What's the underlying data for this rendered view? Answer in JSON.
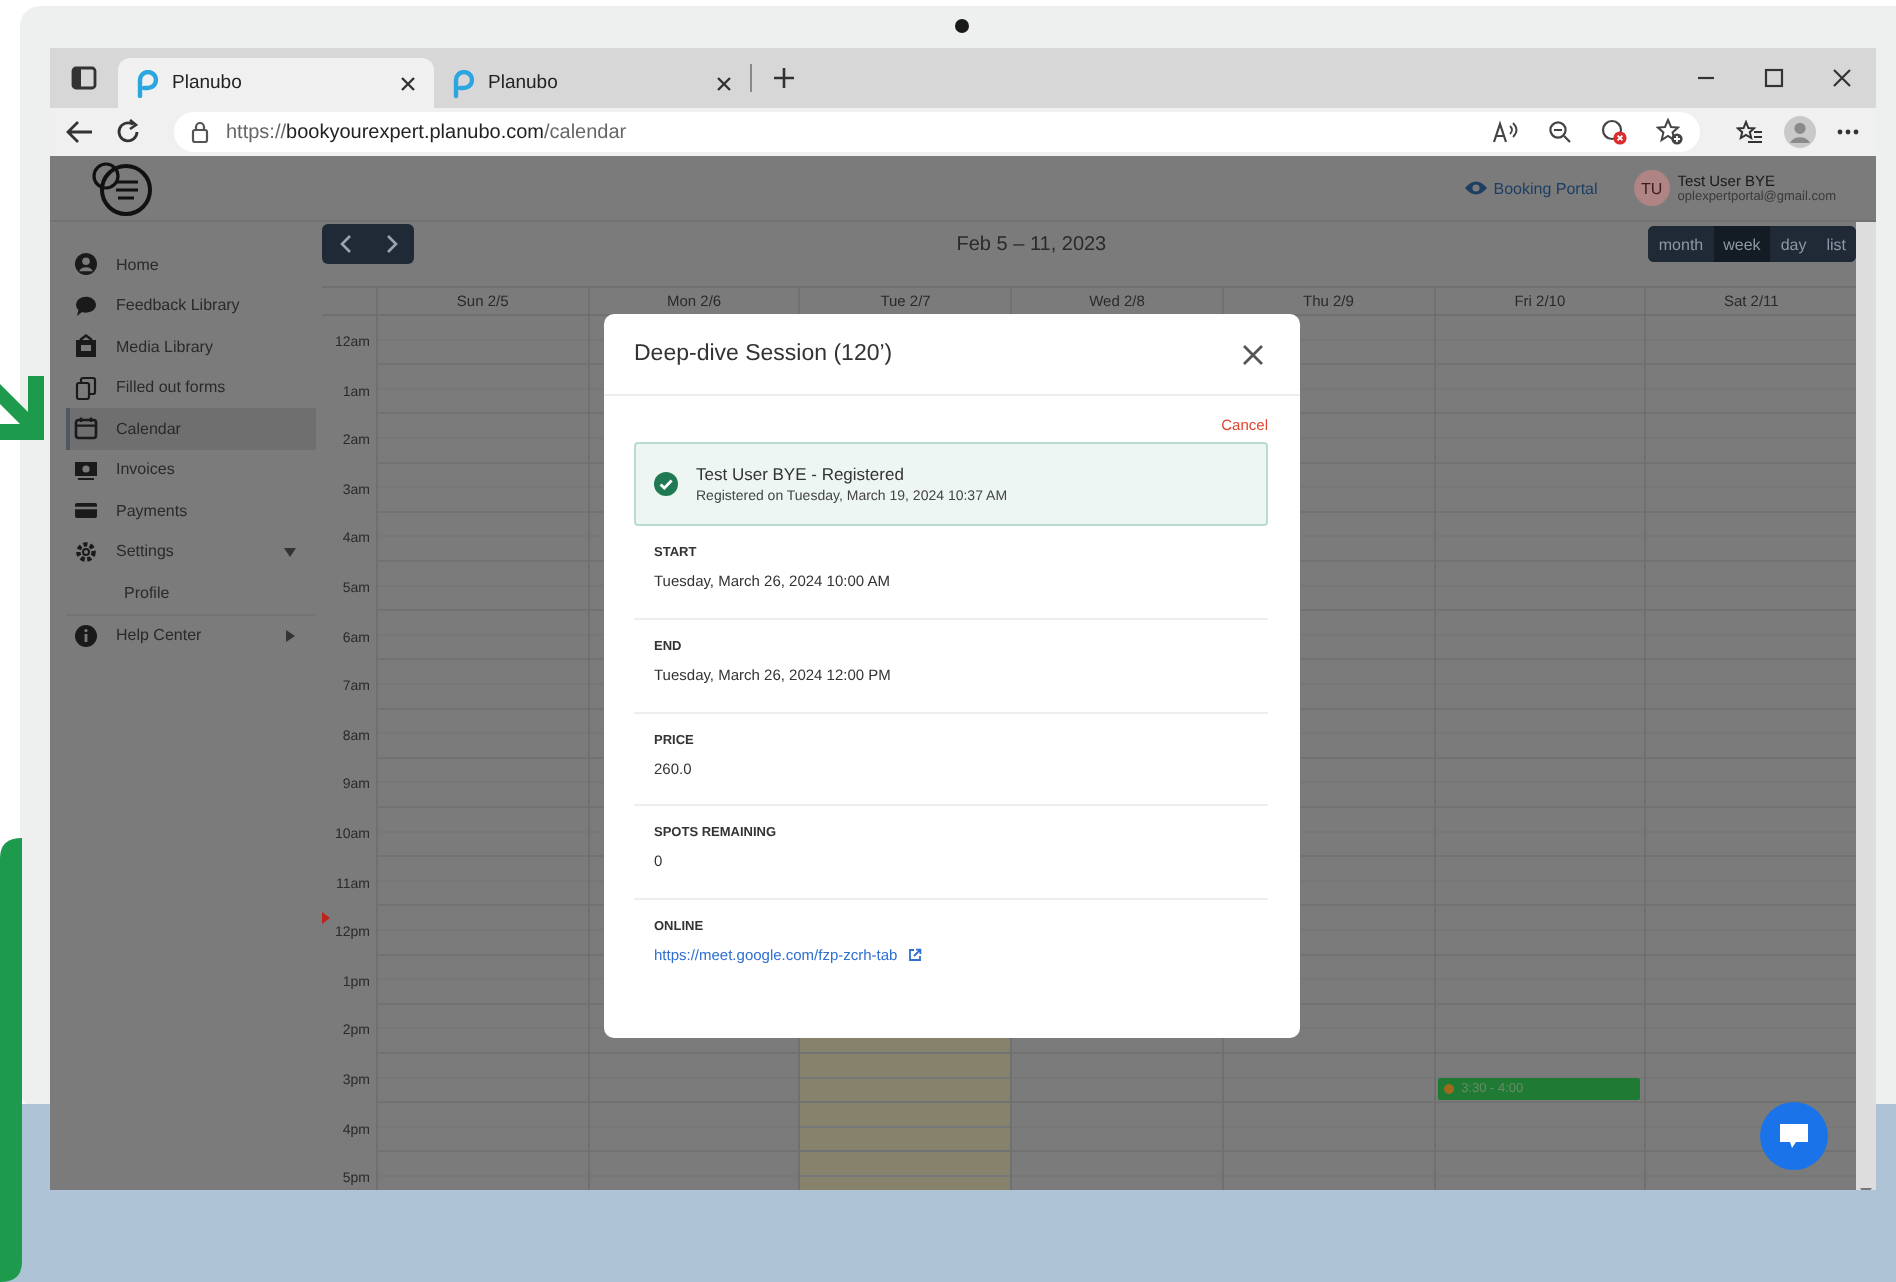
{
  "browser": {
    "tabs": [
      {
        "title": "Planubo",
        "selected": true
      },
      {
        "title": "Planubo",
        "selected": false
      }
    ],
    "url": {
      "scheme": "https://",
      "host": "bookyourexpert.planubo.com",
      "path": "/calendar"
    }
  },
  "header": {
    "portal_link": "Booking Portal",
    "user": {
      "initials": "TU",
      "name": "Test User BYE",
      "email": "oplexpertportal@gmail.com"
    }
  },
  "sidebar": {
    "items": [
      {
        "label": "Home",
        "selected": false
      },
      {
        "label": "Feedback Library",
        "selected": false
      },
      {
        "label": "Media Library",
        "selected": false
      },
      {
        "label": "Filled out forms",
        "selected": false
      },
      {
        "label": "Calendar",
        "selected": true
      },
      {
        "label": "Invoices",
        "selected": false
      },
      {
        "label": "Payments",
        "selected": false
      },
      {
        "label": "Settings",
        "selected": false,
        "expanded": true,
        "children": [
          {
            "label": "Profile",
            "selected": false
          }
        ]
      },
      {
        "label": "Help Center",
        "selected": false,
        "expanded": false
      }
    ]
  },
  "calendar": {
    "range_title": "Feb 5 – 11, 2023",
    "views": [
      {
        "label": "month",
        "selected": false
      },
      {
        "label": "week",
        "selected": true
      },
      {
        "label": "day",
        "selected": false
      },
      {
        "label": "list",
        "selected": false
      }
    ],
    "days": [
      {
        "label": "Sun 2/5",
        "today": false
      },
      {
        "label": "Mon 2/6",
        "today": false
      },
      {
        "label": "Tue 2/7",
        "today": true
      },
      {
        "label": "Wed 2/8",
        "today": false
      },
      {
        "label": "Thu 2/9",
        "today": false
      },
      {
        "label": "Fri 2/10",
        "today": false,
        "events": [
          {
            "time": "3:30 - 4:00"
          }
        ]
      },
      {
        "label": "Sat 2/11",
        "today": false
      }
    ],
    "hours": [
      {
        "label": "12am",
        "now": false
      },
      {
        "label": "1am",
        "now": false
      },
      {
        "label": "2am",
        "now": false
      },
      {
        "label": "3am",
        "now": false
      },
      {
        "label": "4am",
        "now": false
      },
      {
        "label": "5am",
        "now": false
      },
      {
        "label": "6am",
        "now": false
      },
      {
        "label": "7am",
        "now": false
      },
      {
        "label": "8am",
        "now": false
      },
      {
        "label": "9am",
        "now": false
      },
      {
        "label": "10am",
        "now": false
      },
      {
        "label": "11am",
        "now": false
      },
      {
        "label": "12pm",
        "now": true
      },
      {
        "label": "1pm",
        "now": false
      },
      {
        "label": "2pm",
        "now": false
      },
      {
        "label": "3pm",
        "now": false
      },
      {
        "label": "4pm",
        "now": false
      },
      {
        "label": "5pm",
        "now": false
      }
    ]
  },
  "modal": {
    "title": "Deep-dive Session (120’)",
    "cancel": "Cancel",
    "registration": {
      "title": "Test User BYE - Registered",
      "subtitle": "Registered on Tuesday, March 19, 2024 10:37 AM"
    },
    "fields": [
      {
        "label": "START",
        "value": "Tuesday, March 26, 2024 10:00 AM",
        "kind": "text"
      },
      {
        "label": "END",
        "value": "Tuesday, March 26, 2024 12:00 PM",
        "kind": "text"
      },
      {
        "label": "PRICE",
        "value": "260.0",
        "kind": "text"
      },
      {
        "label": "SPOTS REMAINING",
        "value": "0",
        "kind": "text"
      },
      {
        "label": "ONLINE",
        "value": "https://meet.google.com/fzp-zcrh-tab",
        "kind": "link"
      }
    ]
  }
}
